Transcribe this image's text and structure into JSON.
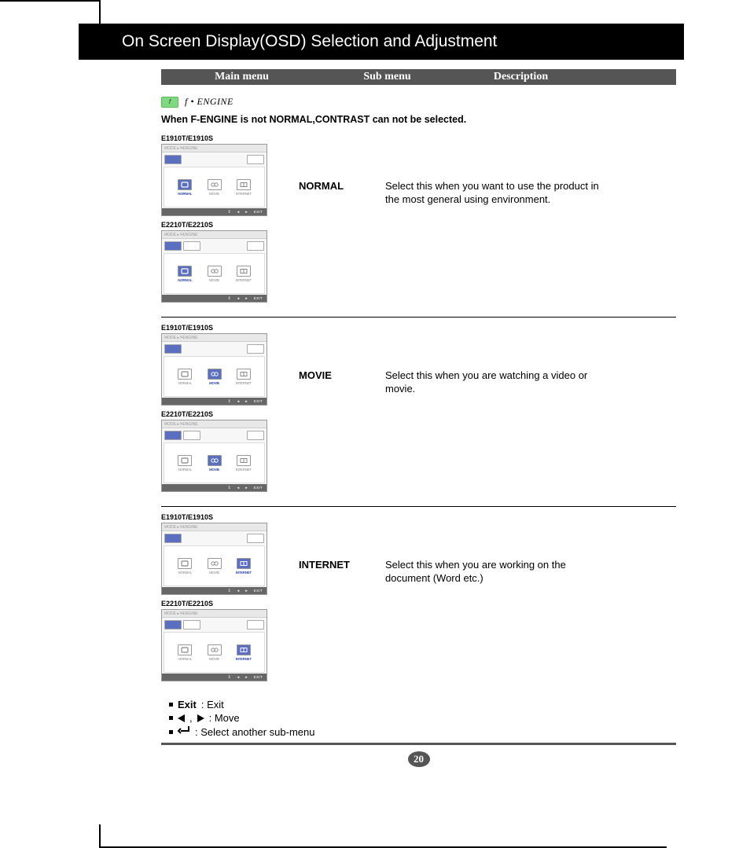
{
  "title": "On Screen Display(OSD) Selection and Adjustment",
  "table_headers": {
    "main": "Main menu",
    "sub": "Sub menu",
    "desc": "Description"
  },
  "fengine": {
    "icon_text": "f",
    "label": "• ENGINE"
  },
  "note": "When F-ENGINE is not NORMAL,CONTRAST can not be selected.",
  "models": {
    "a": "E1910T/E1910S",
    "b": "E2210T/E2210S"
  },
  "osd_title": "MODE ▸ f•ENGINE",
  "osd_options": {
    "normal": "NORMAL",
    "movie": "MOVIE",
    "internet": "INTERNET"
  },
  "osd_exit": "EXIT",
  "sections": [
    {
      "sub": "NORMAL",
      "selected": "normal",
      "desc": "Select this when you want to use the product in the most general using environment."
    },
    {
      "sub": "MOVIE",
      "selected": "movie",
      "desc": "Select this when you are watching a video or movie."
    },
    {
      "sub": "INTERNET",
      "selected": "internet",
      "desc": "Select this when you are working on the document (Word etc.)"
    }
  ],
  "legend": {
    "exit_label": "Exit",
    "exit_desc": ": Exit",
    "move_desc": ": Move",
    "submenu_desc": ": Select another sub-menu",
    "comma": ","
  },
  "page_number": "20"
}
